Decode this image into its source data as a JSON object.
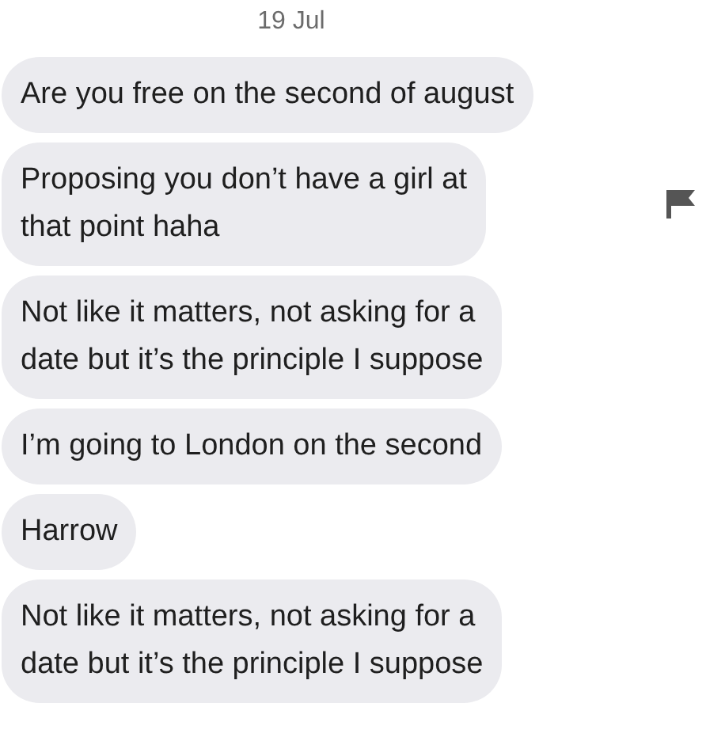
{
  "date_divider": "19 Jul",
  "messages": [
    {
      "lines": [
        "Are you free on the second of august"
      ],
      "flagged": false
    },
    {
      "lines": [
        "Proposing you don’t have a girl at",
        "that point haha"
      ],
      "flagged": true
    },
    {
      "lines": [
        "Not like it matters, not asking for a",
        "date but it’s the principle I suppose"
      ],
      "flagged": false
    },
    {
      "lines": [
        "I’m going to London on the second"
      ],
      "flagged": false
    },
    {
      "lines": [
        "Harrow"
      ],
      "flagged": false
    },
    {
      "lines": [
        "Not like it matters, not asking for a",
        "date but it’s the principle I suppose"
      ],
      "flagged": false
    }
  ]
}
